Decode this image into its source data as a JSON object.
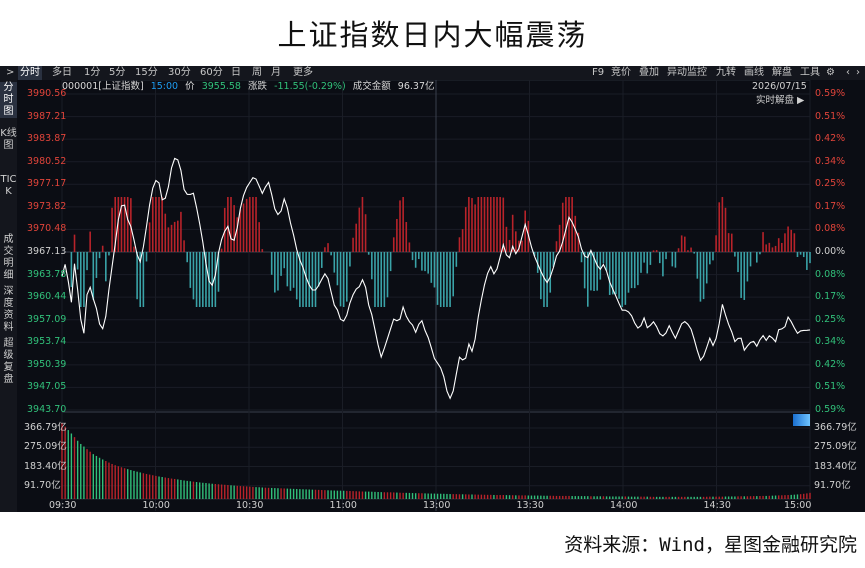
{
  "headline": "上证指数日内大幅震荡",
  "source": "资料来源：Wind，星图金融研究院",
  "toolbar": {
    "collapse": ">",
    "periods": [
      "分时",
      "多日",
      "1分",
      "5分",
      "15分",
      "30分",
      "60分",
      "日",
      "周",
      "月",
      "更多"
    ],
    "active_period": "分时",
    "right_items": [
      "F9",
      "竞价",
      "叠加",
      "异动监控",
      "九转",
      "画线",
      "解盘",
      "工具",
      "⚙",
      "‹",
      "›"
    ]
  },
  "sidebar": {
    "tabs": [
      "分时图",
      "K线图",
      "TICK",
      "成交明细",
      "深度资料",
      "超级复盘"
    ],
    "active_tab": "分时图"
  },
  "info": {
    "code_name": "000001[上证指数]",
    "time": "15:00",
    "price_label": "价",
    "price": "3955.58",
    "change_label": "涨跌",
    "change": "-11.55(-0.29%)",
    "amount_label": "成交金额",
    "amount": "96.37亿",
    "date": "2026/07/15",
    "realtime": "实时解盘 ▶"
  },
  "colors": {
    "up": "#e0443a",
    "down": "#31c07a",
    "bar_up": "#b8232a",
    "bar_down": "#3aa3a8",
    "price_line": "#ffffff",
    "axis_label_time": "#1e9df2"
  },
  "chart_data": {
    "type": "line",
    "title": "上证指数日内大幅震荡",
    "prev_close": 3967.13,
    "y_ticks_left": [
      "3990.56",
      "3987.21",
      "3983.87",
      "3980.52",
      "3977.17",
      "3973.82",
      "3970.48",
      "3967.13",
      "3963.78",
      "3960.44",
      "3957.09",
      "3953.74",
      "3950.39",
      "3947.05",
      "3943.70"
    ],
    "y_ticks_right": [
      "0.59%",
      "0.51%",
      "0.42%",
      "0.34%",
      "0.25%",
      "0.17%",
      "0.08%",
      "0.00%",
      "0.08%",
      "0.17%",
      "0.25%",
      "0.34%",
      "0.42%",
      "0.51%",
      "0.59%"
    ],
    "ylim": [
      3943.7,
      3990.56
    ],
    "volume_ticks": [
      "366.79亿",
      "275.09亿",
      "183.40亿",
      "91.70亿"
    ],
    "volume_max": 458.5,
    "x_ticks": [
      "09:30",
      "10:00",
      "10:30",
      "11:00",
      "13:00",
      "13:30",
      "14:00",
      "14:30",
      "15:00"
    ],
    "series": [
      {
        "values": [
          3963.5,
          3966.0,
          3958.5,
          3966.5,
          3958.0,
          3955.0,
          3963.0,
          3960.5,
          3958.5,
          3955.0,
          3957.5,
          3963.0,
          3967.5,
          3972.5,
          3975.0,
          3972.0,
          3970.5,
          3967.0,
          3965.5,
          3969.5,
          3974.0,
          3977.5,
          3978.0,
          3974.5,
          3975.5,
          3979.5,
          3981.5,
          3980.0,
          3976.0,
          3975.5,
          3976.0,
          3973.0,
          3969.5,
          3965.0,
          3961.5,
          3963.5,
          3968.0,
          3970.0,
          3971.0,
          3968.0,
          3970.5,
          3974.5,
          3976.5,
          3977.5,
          3978.5,
          3977.0,
          3975.5,
          3978.0,
          3975.5,
          3972.5,
          3973.0,
          3975.5,
          3972.0,
          3969.5,
          3966.5,
          3965.0,
          3963.0,
          3961.5,
          3961.5,
          3962.5,
          3964.0,
          3963.0,
          3959.5,
          3958.5,
          3956.5,
          3957.5,
          3960.0,
          3961.5,
          3962.0,
          3963.5,
          3959.5,
          3957.5,
          3954.0,
          3951.5,
          3953.5,
          3955.5,
          3957.5,
          3956.5,
          3959.0,
          3957.0,
          3956.5,
          3955.0,
          3957.5,
          3955.5,
          3954.0,
          3951.5,
          3950.5,
          3949.5,
          3946.5,
          3945.0,
          3948.5,
          3952.0,
          3950.5,
          3953.5,
          3952.0,
          3957.0,
          3960.5,
          3963.5,
          3965.0,
          3963.5,
          3966.0,
          3968.5,
          3965.5,
          3968.0,
          3966.5,
          3969.0,
          3971.5,
          3968.5,
          3966.5,
          3965.0,
          3963.5,
          3962.5,
          3964.0,
          3966.5,
          3967.5,
          3970.0,
          3972.5,
          3971.0,
          3969.5,
          3967.0,
          3966.0,
          3967.5,
          3965.5,
          3964.5,
          3965.5,
          3963.0,
          3961.5,
          3960.0,
          3958.5,
          3958.5,
          3958.0,
          3956.5,
          3955.5,
          3957.5,
          3955.5,
          3957.0,
          3956.0,
          3954.5,
          3955.0,
          3956.5,
          3954.0,
          3955.5,
          3957.0,
          3956.5,
          3955.5,
          3953.0,
          3951.0,
          3952.0,
          3954.5,
          3953.0,
          3955.5,
          3959.5,
          3957.0,
          3955.5,
          3953.5,
          3955.0,
          3952.5,
          3953.5,
          3954.0,
          3953.0,
          3955.0,
          3954.0,
          3955.0,
          3953.5,
          3956.0,
          3955.5,
          3957.5,
          3956.5,
          3955.0,
          3955.5,
          3955.5,
          3955.58
        ]
      }
    ],
    "volume": [
      420,
      392,
      366,
      338,
      310,
      290,
      270,
      250,
      236,
      222,
      210,
      198,
      188,
      180,
      172,
      165,
      158,
      152,
      146,
      140,
      135,
      130,
      125,
      121,
      117,
      113,
      110,
      106,
      102,
      99,
      96,
      93,
      90,
      88,
      85,
      83,
      81,
      79,
      77,
      75,
      73,
      71,
      70,
      68,
      66,
      65,
      63,
      62,
      61,
      60,
      59,
      58,
      57,
      56,
      55,
      54,
      53,
      52,
      51,
      50,
      49,
      48,
      47,
      46,
      46,
      45,
      44,
      43,
      42,
      41,
      41,
      40,
      39,
      38,
      37,
      37,
      36,
      35,
      34,
      34,
      33,
      32,
      32,
      31,
      30,
      30,
      29,
      29,
      28,
      27,
      27,
      26,
      26,
      25,
      25,
      24,
      24,
      23,
      23,
      22,
      22,
      22,
      21,
      21,
      20,
      20,
      20,
      19,
      19,
      19,
      18,
      18,
      18,
      17,
      17,
      17,
      17,
      16,
      16,
      16,
      16,
      15,
      15,
      15,
      15,
      14,
      14,
      14,
      14,
      14,
      13,
      13,
      13,
      13,
      13,
      12,
      12,
      12,
      12,
      12,
      12,
      12,
      12,
      12,
      12,
      12,
      12,
      12,
      13,
      13,
      13,
      13,
      14,
      14,
      14,
      15,
      15,
      15,
      16,
      16,
      17,
      17,
      18,
      19,
      20,
      21,
      22,
      23,
      25,
      27,
      30,
      34
    ]
  }
}
